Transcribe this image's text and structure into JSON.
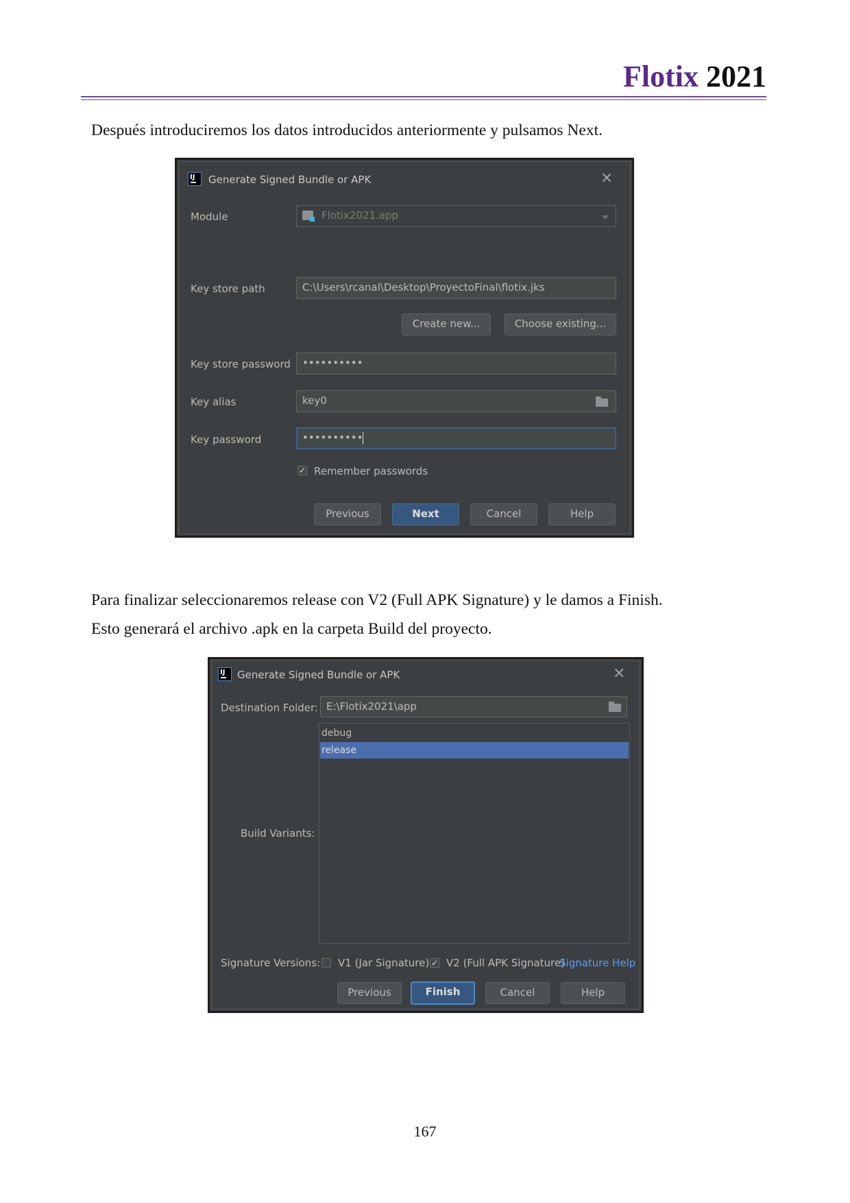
{
  "header": {
    "brand": "Flotix",
    "year": "2021"
  },
  "paragraphs": {
    "p1": "Después introduciremos los datos introducidos anteriormente y pulsamos Next.",
    "p2": "Para finalizar seleccionaremos release con V2 (Full APK Signature) y le damos a Finish.",
    "p3": "Esto generará el archivo .apk en la carpeta Build del proyecto."
  },
  "dialog1": {
    "title": "Generate Signed Bundle or APK",
    "icon_text": "IJ",
    "close_symbol": "×",
    "module_label": "Module",
    "module_value": "Flotix2021.app",
    "keystore_path_label": "Key store path",
    "keystore_path_value": "C:\\Users\\rcanal\\Desktop\\ProyectoFinal\\flotix.jks",
    "create_new_label": "Create new...",
    "choose_existing_label": "Choose existing...",
    "keystore_password_label": "Key store password",
    "keystore_password_value": "••••••••••",
    "key_alias_label": "Key alias",
    "key_alias_value": "key0",
    "key_password_label": "Key password",
    "key_password_value": "••••••••••",
    "remember_label": "Remember passwords",
    "remember_checked": true,
    "buttons": {
      "previous": "Previous",
      "next": "Next",
      "cancel": "Cancel",
      "help": "Help"
    }
  },
  "dialog2": {
    "title": "Generate Signed Bundle or APK",
    "icon_text": "IJ",
    "close_symbol": "×",
    "destination_label": "Destination Folder:",
    "destination_value": "E:\\Flotix2021\\app",
    "build_variants_label": "Build Variants:",
    "variants": [
      "debug",
      "release"
    ],
    "selected_variant": "release",
    "signature_versions_label": "Signature Versions:",
    "v1_label": "V1 (Jar Signature)",
    "v1_checked": false,
    "v2_label": "V2 (Full APK Signature)",
    "v2_checked": true,
    "signature_help_label": "Signature Help",
    "buttons": {
      "previous": "Previous",
      "finish": "Finish",
      "cancel": "Cancel",
      "help": "Help"
    }
  },
  "check_symbol": "✓",
  "page_number": "167",
  "colors": {
    "brand": "#5b2a8c",
    "dialog_bg": "#3c3f41",
    "selection": "#4b6eaf",
    "link": "#589df6",
    "primary_button": "#365880"
  }
}
